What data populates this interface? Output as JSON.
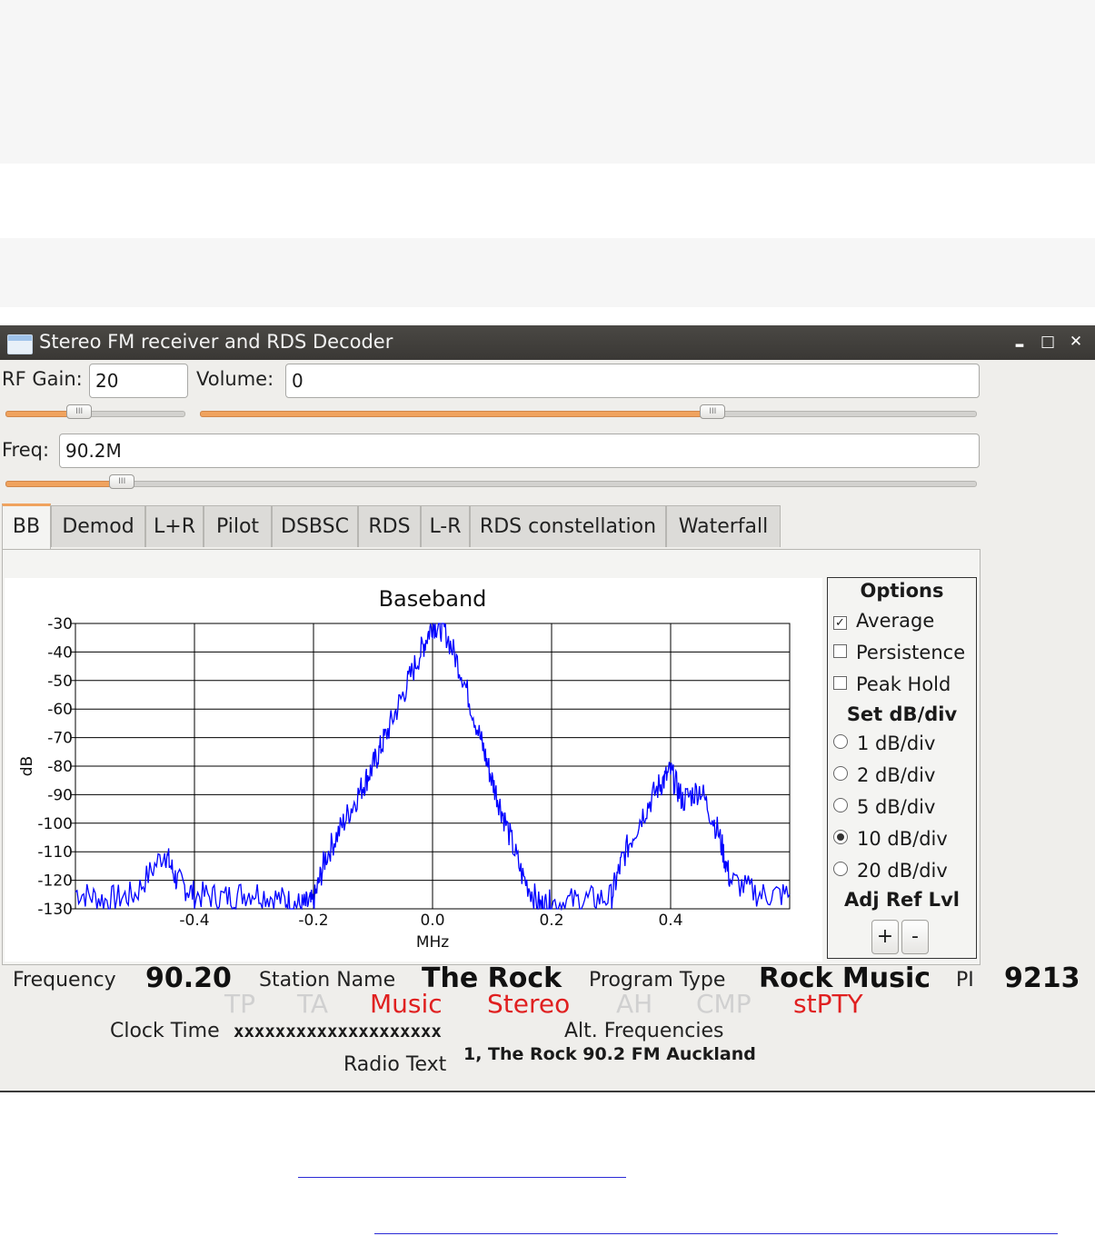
{
  "window": {
    "title": "Stereo FM receiver and RDS Decoder",
    "controls": {
      "minimize": "▂",
      "maximize": "□",
      "close": "✕"
    }
  },
  "controls": {
    "rf_gain_label": "RF Gain:",
    "rf_gain_value": "20",
    "volume_label": "Volume:",
    "volume_value": "0",
    "freq_label": "Freq:",
    "freq_value": "90.2M",
    "rf_gain_slider_level": 0.41,
    "volume_slider_level": 0.66,
    "freq_slider_level": 0.12
  },
  "tabs": [
    {
      "label": "BB",
      "active": true
    },
    {
      "label": "Demod"
    },
    {
      "label": "L+R"
    },
    {
      "label": "Pilot"
    },
    {
      "label": "DSBSC"
    },
    {
      "label": "RDS"
    },
    {
      "label": "L-R"
    },
    {
      "label": "RDS constellation"
    },
    {
      "label": "Waterfall"
    }
  ],
  "chart_data": {
    "type": "line",
    "title": "Baseband",
    "xlabel": "MHz",
    "ylabel": "dB",
    "xlim": [
      -0.6,
      0.6
    ],
    "ylim": [
      -130,
      -30
    ],
    "xticks": [
      "-0.4",
      "-0.2",
      "0.0",
      "0.2",
      "0.4"
    ],
    "xtick_values": [
      -0.4,
      -0.2,
      0.0,
      0.2,
      0.4
    ],
    "yticks": [
      "-30",
      "-40",
      "-50",
      "-60",
      "-70",
      "-80",
      "-90",
      "-100",
      "-110",
      "-120",
      "-130"
    ],
    "grid": true,
    "line_color": "#0000ff",
    "series": [
      {
        "x": [
          -0.6,
          -0.55,
          -0.5,
          -0.45,
          -0.43,
          -0.4,
          -0.35,
          -0.3,
          -0.25,
          -0.22,
          -0.2,
          -0.18,
          -0.15,
          -0.12,
          -0.1,
          -0.08,
          -0.05,
          -0.02,
          0.0,
          0.02,
          0.05,
          0.08,
          0.1,
          0.12,
          0.15,
          0.18,
          0.2,
          0.25,
          0.3,
          0.32,
          0.35,
          0.38,
          0.4,
          0.42,
          0.45,
          0.48,
          0.5,
          0.55,
          0.6
        ],
        "y": [
          -124,
          -127,
          -125,
          -110,
          -120,
          -125,
          -126,
          -124,
          -127,
          -129,
          -128,
          -112,
          -100,
          -88,
          -80,
          -70,
          -55,
          -40,
          -30,
          -32,
          -48,
          -70,
          -85,
          -98,
          -118,
          -129,
          -128,
          -127,
          -126,
          -112,
          -98,
          -87,
          -82,
          -92,
          -88,
          -103,
          -120,
          -125,
          -125
        ]
      }
    ]
  },
  "options": {
    "title": "Options",
    "average": "Average",
    "persistence": "Persistence",
    "peak_hold": "Peak Hold",
    "set_db_title": "Set dB/div",
    "db_options": [
      "1 dB/div",
      "2 dB/div",
      "5 dB/div",
      "10 dB/div",
      "20 dB/div"
    ],
    "db_selected_index": 3,
    "average_checked": true,
    "adj_ref_title": "Adj Ref Lvl",
    "plus": "+",
    "minus": "-",
    "check_mark": "✓"
  },
  "rds": {
    "frequency_label": "Frequency",
    "frequency_value": "90.20",
    "station_name_label": "Station Name",
    "station_name_value": "The Rock",
    "program_type_label": "Program Type",
    "program_type_value": "Rock Music",
    "pi_label": "PI",
    "pi_value": "9213",
    "flags": {
      "tp": "TP",
      "ta": "TA",
      "music": "Music",
      "stereo": "Stereo",
      "ah": "AH",
      "cmp": "CMP",
      "stpty": "stPTY"
    },
    "active_color": "#e02020",
    "inactive_color": "#d0d0d0",
    "clock_time_label": "Clock Time",
    "clock_time_value": "xxxxxxxxxxxxxxxxxxxx",
    "alt_frequencies_label": "Alt. Frequencies",
    "radio_text_label": "Radio Text",
    "radio_text_value": "1, The Rock 90.2 FM Auckland"
  }
}
